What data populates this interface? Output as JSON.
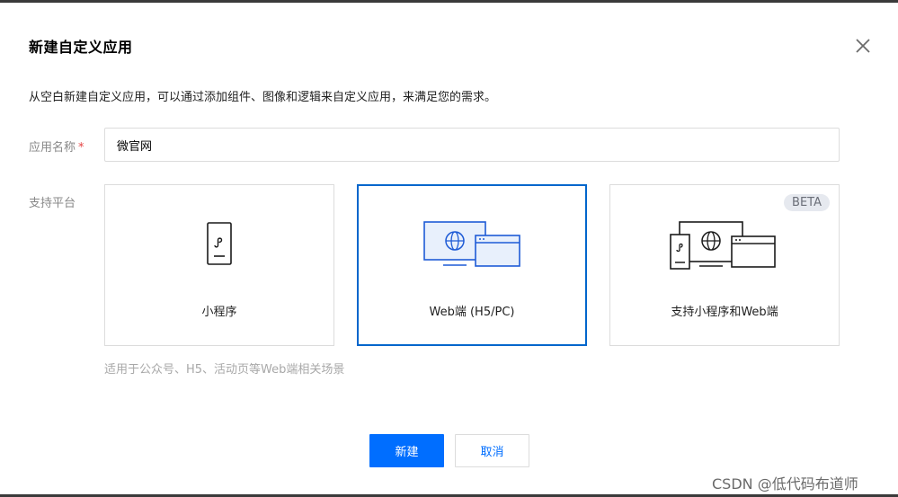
{
  "dialog": {
    "title": "新建自定义应用",
    "description": "从空白新建自定义应用，可以通过添加组件、图像和逻辑来自定义应用，来满足您的需求。"
  },
  "form": {
    "name_label": "应用名称",
    "required_mark": "*",
    "name_value": "微官网",
    "platform_label": "支持平台"
  },
  "platforms": [
    {
      "label": "小程序",
      "icon": "mini-program-phone-icon",
      "selected": false
    },
    {
      "label": "Web端 (H5/PC)",
      "icon": "web-browser-icon",
      "selected": true
    },
    {
      "label": "支持小程序和Web端",
      "icon": "mini-program-and-web-icon",
      "selected": false,
      "badge": "BETA"
    }
  ],
  "platform_hint": "适用于公众号、H5、活动页等Web端相关场景",
  "buttons": {
    "create": "新建",
    "cancel": "取消"
  },
  "watermark": "CSDN @低代码布道师",
  "colors": {
    "primary": "#006eff",
    "selected_border": "#0066cc",
    "icon_blue": "#1e5bd6",
    "required": "#e54545"
  }
}
